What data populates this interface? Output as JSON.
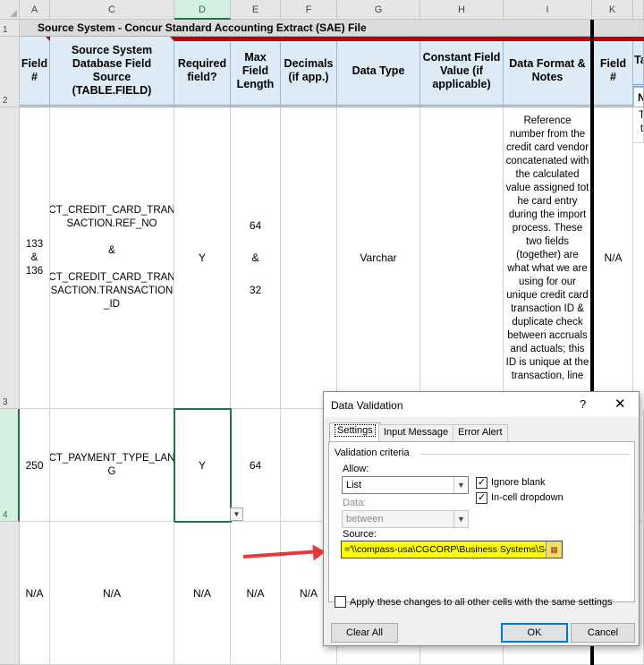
{
  "columns": [
    "A",
    "C",
    "D",
    "E",
    "F",
    "G",
    "H",
    "I",
    "K"
  ],
  "rows": [
    "1",
    "2",
    "3",
    "4"
  ],
  "title_row": "Source System - Concur Standard Accounting Extract (SAE) File",
  "headers": {
    "field_no": "Field\n#",
    "source_field": "Source System\nDatabase Field Source\n(TABLE.FIELD)",
    "required": "Required\nfield?",
    "max_length": "Max\nField\nLength",
    "decimals": "Decimals\n(if app.)",
    "data_type": "Data Type",
    "constant": "Constant Field\nValue (if\napplicable)",
    "format": "Data Format &\nNotes",
    "field_no_k": "Field\n#",
    "partial_1": "Ta",
    "partial_2": "N",
    "partial_3": "T\nt"
  },
  "row3": {
    "field_no": "133\n&\n136",
    "source_field": "CT_CREDIT_CARD_TRAN\nSACTION.REF_NO\n\n&\n\nCT_CREDIT_CARD_TRAN\nSACTION.TRANSACTION\n_ID",
    "required": "Y",
    "max_length": "64\n\n&\n\n32",
    "data_type": "Varchar",
    "format": "Reference number from the credit card vendor concatenated with the calculated value assigned tot he card entry during the import process. These two fields (together) are what what we are using for our unique credit card transaction ID & duplicate check between accruals and actuals; this ID is unique at the transaction, line",
    "field_no_k": "N/A"
  },
  "row4": {
    "field_no": "250",
    "source_field": "CT_PAYMENT_TYPE_LAN\nG",
    "required": "Y",
    "max_length": "64"
  },
  "row5": {
    "field_no": "N/A",
    "source_field": "N/A",
    "required": "N/A",
    "max_length": "N/A",
    "decimals": "N/A"
  },
  "dialog": {
    "title": "Data Validation",
    "help": "?",
    "close": "✕",
    "tabs": [
      "Settings",
      "Input Message",
      "Error Alert"
    ],
    "group_label": "Validation criteria",
    "allow_label": "Allow:",
    "allow_value": "List",
    "data_label": "Data:",
    "data_value": "between",
    "ignore_blank": "Ignore blank",
    "in_cell_dropdown": "In-cell dropdown",
    "source_label": "Source:",
    "source_value": "='\\\\compass-usa\\CGCORP\\Business Systems\\Se",
    "apply_all": "Apply these changes to all other cells with the same settings",
    "clear_all": "Clear All",
    "ok": "OK",
    "cancel": "Cancel"
  },
  "colors": {
    "header_fill": "#ddebf7",
    "selection": "#217346",
    "highlight": "#ffff00",
    "arrow": "#e53a3a"
  }
}
